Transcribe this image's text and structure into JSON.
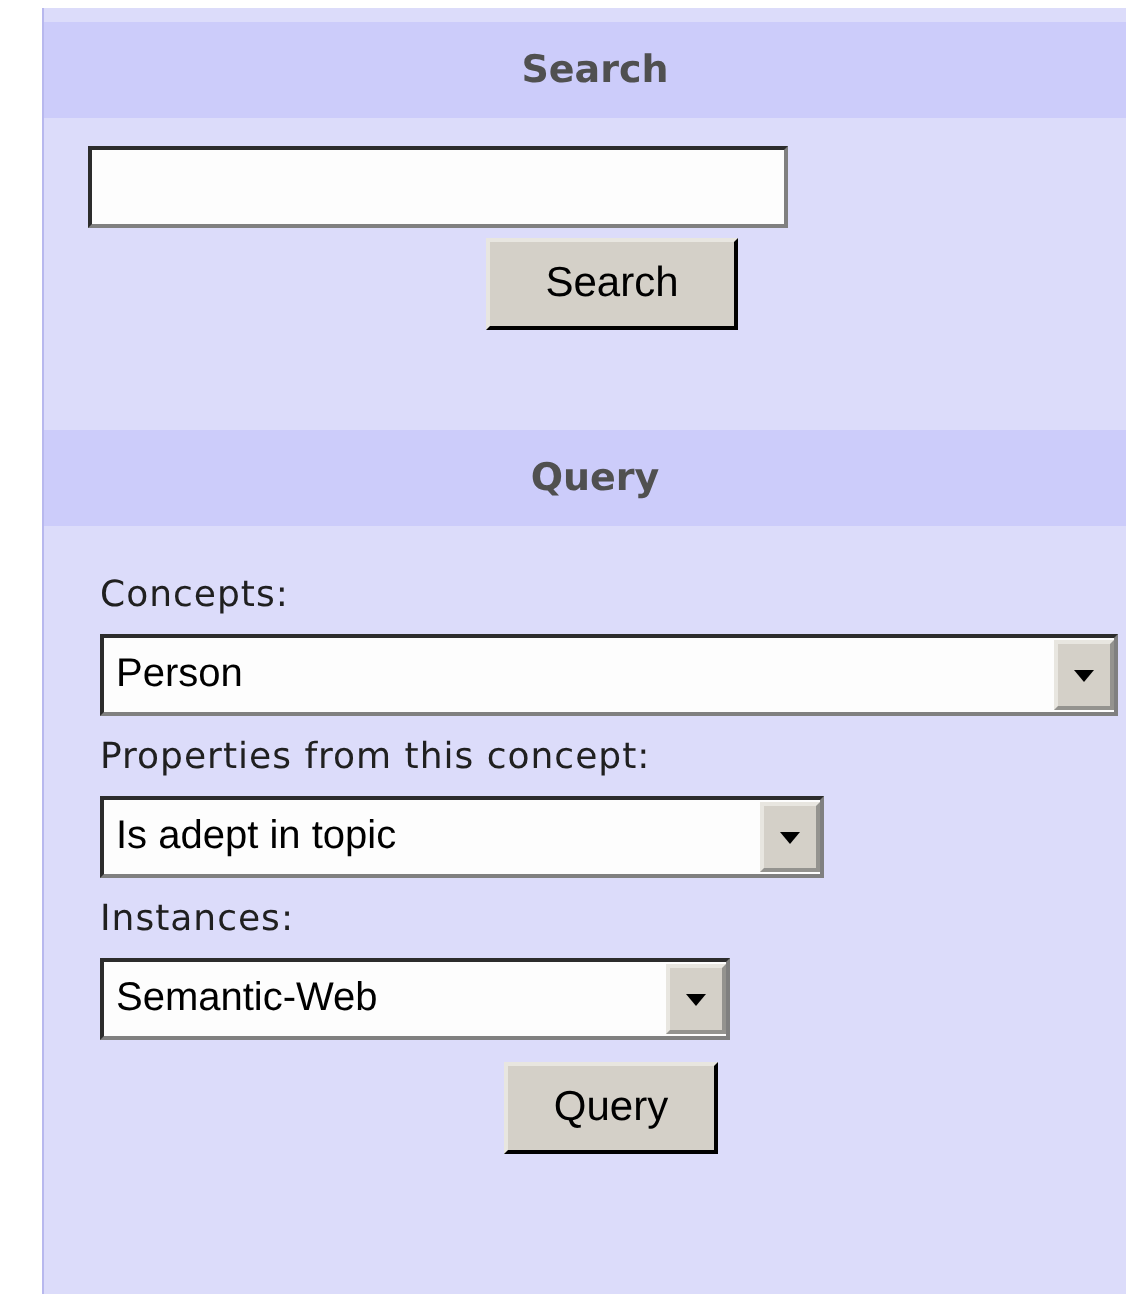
{
  "search": {
    "title": "Search",
    "button": "Search"
  },
  "query": {
    "title": "Query",
    "fields": [
      {
        "label": "Concepts:",
        "value": "Person"
      },
      {
        "label": "Properties from this concept:",
        "value": "Is adept in topic"
      },
      {
        "label": "Instances:",
        "value": "Semantic-Web"
      }
    ],
    "button": "Query"
  }
}
